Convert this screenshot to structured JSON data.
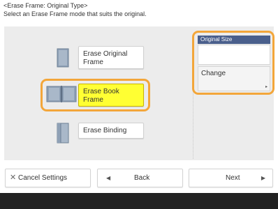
{
  "header": {
    "title": "<Erase Frame: Original Type>",
    "subtitle": "Select an Erase Frame mode that suits the original."
  },
  "modes": [
    {
      "label_line1": "Erase Original",
      "label_line2": "Frame",
      "selected": false,
      "icon": "single-page-icon"
    },
    {
      "label_line1": "Erase Book",
      "label_line2": "Frame",
      "selected": true,
      "icon": "open-book-icon"
    },
    {
      "label_line1": "Erase Binding",
      "label_line2": "",
      "selected": false,
      "icon": "binding-page-icon"
    }
  ],
  "original_size": {
    "title": "Original Size",
    "value": "",
    "change_label": "Change"
  },
  "bottom_bar": {
    "cancel_label": "Cancel Settings",
    "back_label": "Back",
    "next_label": "Next"
  },
  "colors": {
    "selected_yellow": "#ffff33",
    "highlight_orange": "#f3a63a",
    "panel_title_blue": "#4a5f8c"
  }
}
